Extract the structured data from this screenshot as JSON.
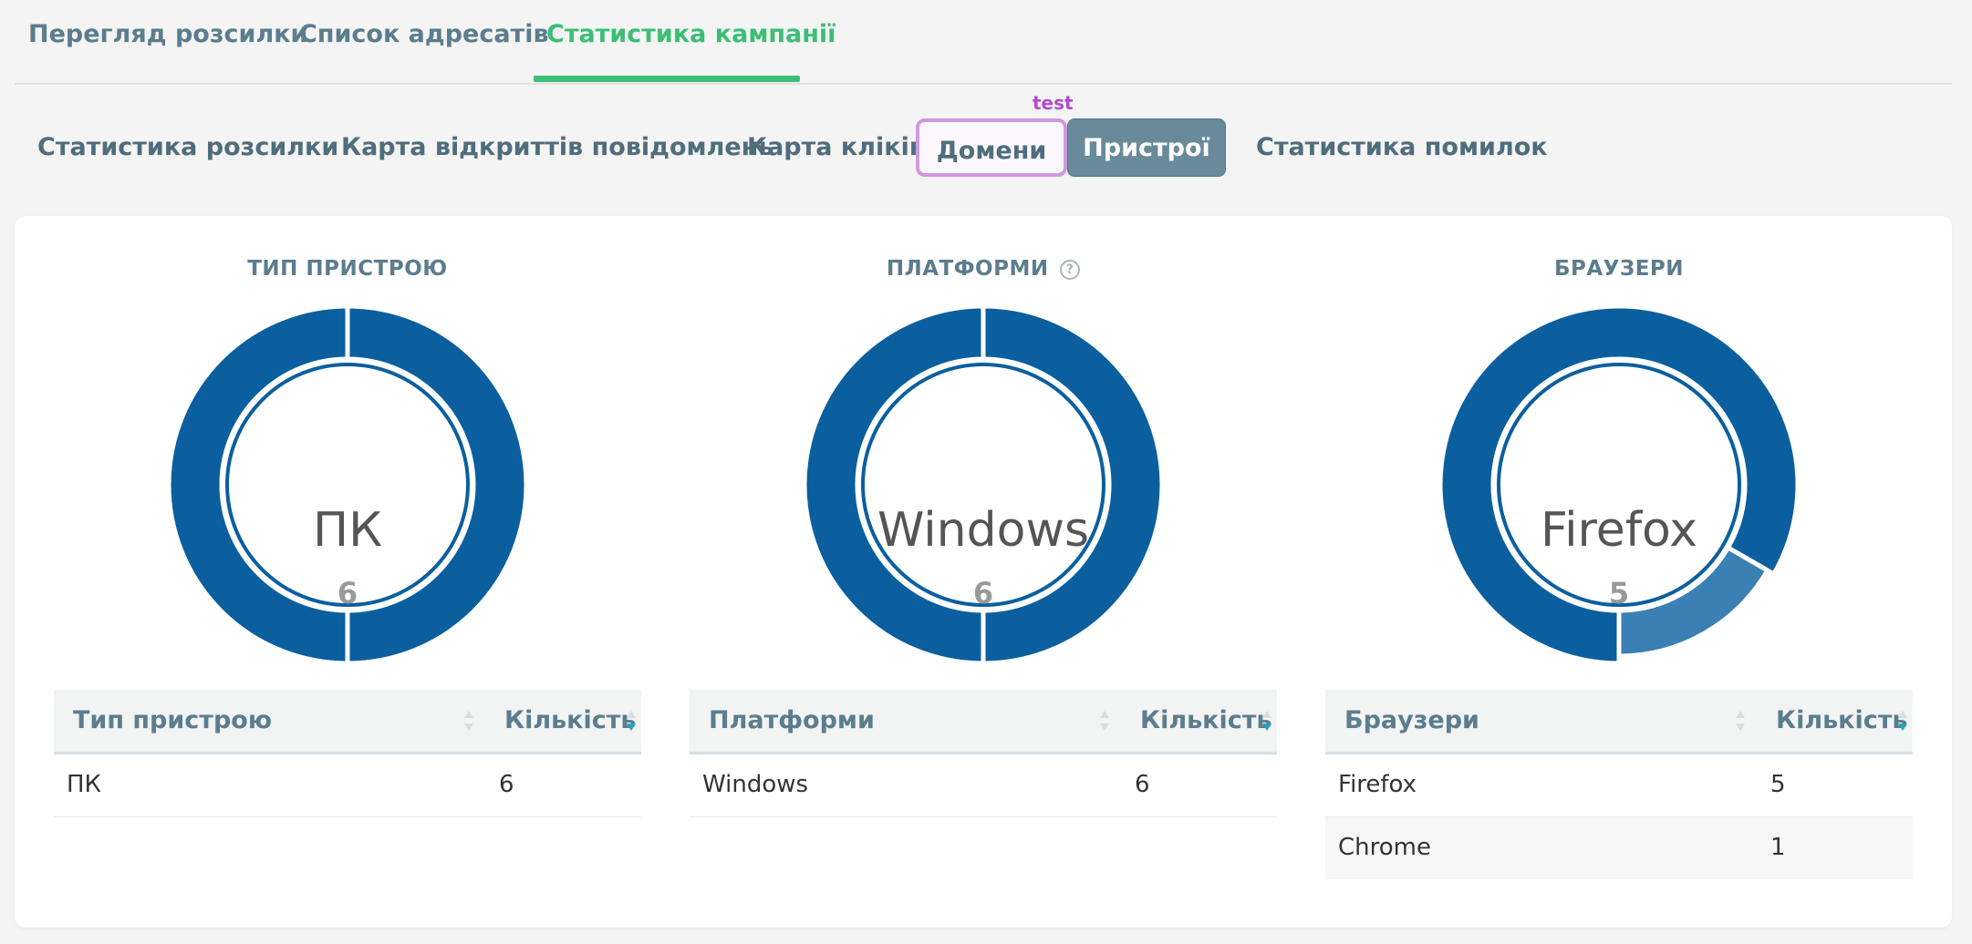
{
  "top_tabs": [
    {
      "label": "Перегляд розсилки",
      "active": false
    },
    {
      "label": "Список адресатів",
      "active": false
    },
    {
      "label": "Статистика кампанії",
      "active": true
    }
  ],
  "sub_tabs": [
    {
      "label": "Статистика розсилки",
      "state": "normal"
    },
    {
      "label": "Карта відкриттів повідомлень",
      "state": "normal"
    },
    {
      "label": "Карта кліків",
      "state": "normal"
    },
    {
      "label": "Домени",
      "state": "outlined"
    },
    {
      "label": "Пристрої",
      "state": "active"
    },
    {
      "label": "Статистика помилок",
      "state": "normal"
    }
  ],
  "test_label": "test",
  "colors": {
    "accent_green": "#3cbe75",
    "donut_primary": "#0b5f9f",
    "donut_secondary": "#3a80b4",
    "tab_text": "#5b7d8e",
    "test_purple": "#b24bd0"
  },
  "panels": [
    {
      "title": "ТИП ПРИСТРОЮ",
      "has_help": false,
      "center_label": "ПК",
      "center_count": "6",
      "slices": [
        6
      ],
      "columns": [
        "Тип пристрою",
        "Кількість"
      ],
      "rows": [
        [
          "ПК",
          "6"
        ]
      ]
    },
    {
      "title": "ПЛАТФОРМИ",
      "has_help": true,
      "help_icon": "?",
      "center_label": "Windows",
      "center_count": "6",
      "slices": [
        6
      ],
      "columns": [
        "Платформи",
        "Кількість"
      ],
      "rows": [
        [
          "Windows",
          "6"
        ]
      ]
    },
    {
      "title": "БРАУЗЕРИ",
      "has_help": false,
      "center_label": "Firefox",
      "center_count": "5",
      "slices": [
        5,
        1
      ],
      "columns": [
        "Браузери",
        "Кількість"
      ],
      "rows": [
        [
          "Firefox",
          "5"
        ],
        [
          "Chrome",
          "1"
        ]
      ]
    }
  ]
}
